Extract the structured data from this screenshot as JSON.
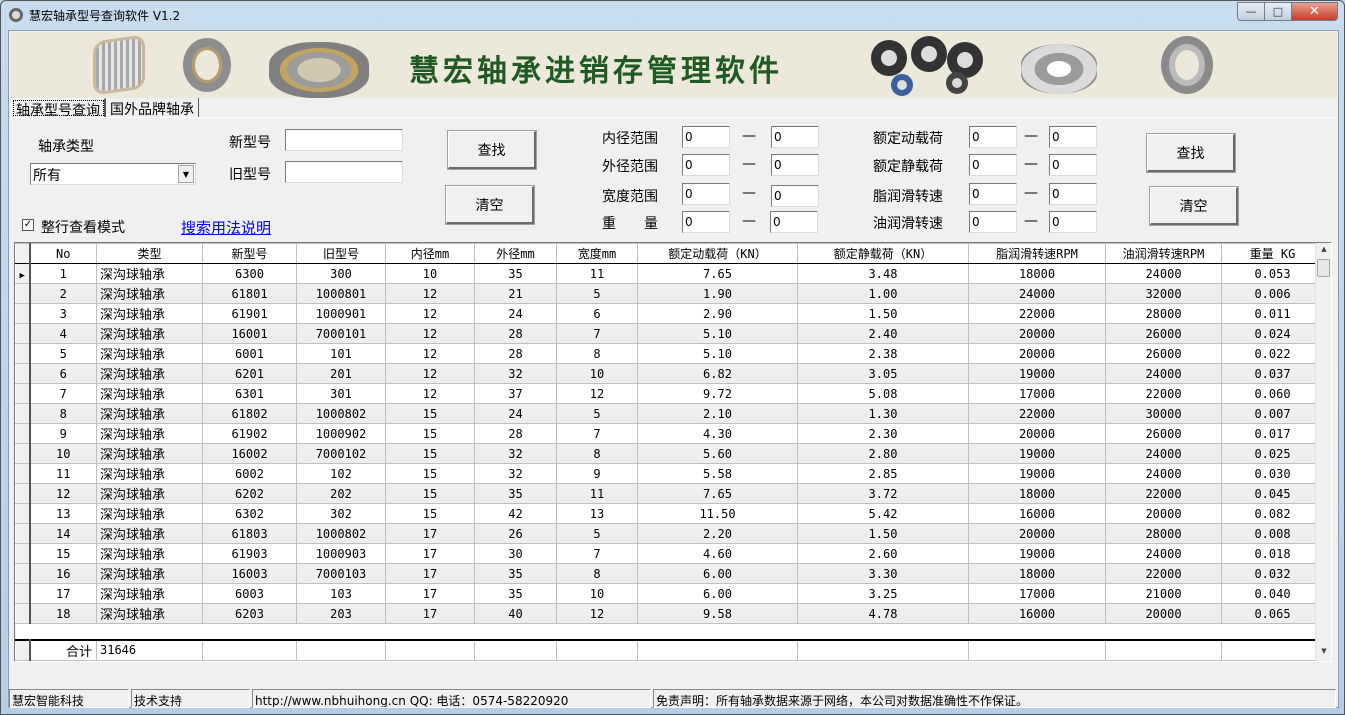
{
  "window": {
    "title": "慧宏轴承型号查询软件 V1.2",
    "minimize": "—",
    "maximize": "□",
    "close": "✕"
  },
  "banner": {
    "title": "慧宏轴承进销存管理软件"
  },
  "tabs": [
    {
      "label": "轴承型号查询",
      "active": true
    },
    {
      "label": "国外品牌轴承",
      "active": false
    }
  ],
  "search": {
    "type_label": "轴承类型",
    "type_value": "所有",
    "new_model_label": "新型号",
    "new_model_value": "",
    "old_model_label": "旧型号",
    "old_model_value": "",
    "find_button": "查找",
    "clear_button": "清空",
    "row_view_label": "整行查看模式",
    "row_view_checked": true,
    "help_link": "搜索用法说明",
    "dash": "—",
    "ranges_left": [
      {
        "label": "内径范围",
        "from": "0",
        "to": "0"
      },
      {
        "label": "外径范围",
        "from": "0",
        "to": "0"
      },
      {
        "label": "宽度范围",
        "from": "0",
        "to": "0"
      },
      {
        "label": "重　　量",
        "from": "0",
        "to": "0"
      }
    ],
    "ranges_right": [
      {
        "label": "额定动载荷",
        "from": "0",
        "to": "0"
      },
      {
        "label": "额定静载荷",
        "from": "0",
        "to": "0"
      },
      {
        "label": "脂润滑转速",
        "from": "0",
        "to": "0"
      },
      {
        "label": "油润滑转速",
        "from": "0",
        "to": "0"
      }
    ],
    "find_button_2": "查找",
    "clear_button_2": "清空"
  },
  "table": {
    "columns": [
      "No",
      "类型",
      "新型号",
      "旧型号",
      "内径mm",
      "外径mm",
      "宽度mm",
      "额定动载荷（KN）",
      "额定静载荷（KN）",
      "脂润滑转速RPM",
      "油润滑转速RPM",
      "重量 KG"
    ],
    "rows": [
      [
        "1",
        "深沟球轴承",
        "6300",
        "300",
        "10",
        "35",
        "11",
        "7.65",
        "3.48",
        "18000",
        "24000",
        "0.053"
      ],
      [
        "2",
        "深沟球轴承",
        "61801",
        "1000801",
        "12",
        "21",
        "5",
        "1.90",
        "1.00",
        "24000",
        "32000",
        "0.006"
      ],
      [
        "3",
        "深沟球轴承",
        "61901",
        "1000901",
        "12",
        "24",
        "6",
        "2.90",
        "1.50",
        "22000",
        "28000",
        "0.011"
      ],
      [
        "4",
        "深沟球轴承",
        "16001",
        "7000101",
        "12",
        "28",
        "7",
        "5.10",
        "2.40",
        "20000",
        "26000",
        "0.024"
      ],
      [
        "5",
        "深沟球轴承",
        "6001",
        "101",
        "12",
        "28",
        "8",
        "5.10",
        "2.38",
        "20000",
        "26000",
        "0.022"
      ],
      [
        "6",
        "深沟球轴承",
        "6201",
        "201",
        "12",
        "32",
        "10",
        "6.82",
        "3.05",
        "19000",
        "24000",
        "0.037"
      ],
      [
        "7",
        "深沟球轴承",
        "6301",
        "301",
        "12",
        "37",
        "12",
        "9.72",
        "5.08",
        "17000",
        "22000",
        "0.060"
      ],
      [
        "8",
        "深沟球轴承",
        "61802",
        "1000802",
        "15",
        "24",
        "5",
        "2.10",
        "1.30",
        "22000",
        "30000",
        "0.007"
      ],
      [
        "9",
        "深沟球轴承",
        "61902",
        "1000902",
        "15",
        "28",
        "7",
        "4.30",
        "2.30",
        "20000",
        "26000",
        "0.017"
      ],
      [
        "10",
        "深沟球轴承",
        "16002",
        "7000102",
        "15",
        "32",
        "8",
        "5.60",
        "2.80",
        "19000",
        "24000",
        "0.025"
      ],
      [
        "11",
        "深沟球轴承",
        "6002",
        "102",
        "15",
        "32",
        "9",
        "5.58",
        "2.85",
        "19000",
        "24000",
        "0.030"
      ],
      [
        "12",
        "深沟球轴承",
        "6202",
        "202",
        "15",
        "35",
        "11",
        "7.65",
        "3.72",
        "18000",
        "22000",
        "0.045"
      ],
      [
        "13",
        "深沟球轴承",
        "6302",
        "302",
        "15",
        "42",
        "13",
        "11.50",
        "5.42",
        "16000",
        "20000",
        "0.082"
      ],
      [
        "14",
        "深沟球轴承",
        "61803",
        "1000802",
        "17",
        "26",
        "5",
        "2.20",
        "1.50",
        "20000",
        "28000",
        "0.008"
      ],
      [
        "15",
        "深沟球轴承",
        "61903",
        "1000903",
        "17",
        "30",
        "7",
        "4.60",
        "2.60",
        "19000",
        "24000",
        "0.018"
      ],
      [
        "16",
        "深沟球轴承",
        "16003",
        "7000103",
        "17",
        "35",
        "8",
        "6.00",
        "3.30",
        "18000",
        "22000",
        "0.032"
      ],
      [
        "17",
        "深沟球轴承",
        "6003",
        "103",
        "17",
        "35",
        "10",
        "6.00",
        "3.25",
        "17000",
        "21000",
        "0.040"
      ],
      [
        "18",
        "深沟球轴承",
        "6203",
        "203",
        "17",
        "40",
        "12",
        "9.58",
        "4.78",
        "16000",
        "20000",
        "0.065"
      ]
    ],
    "selected_row": 0,
    "total_label": "合计",
    "total_value": "31646"
  },
  "statusbar": {
    "company": "慧宏智能科技",
    "support": "技术支持",
    "contact": "http://www.nbhuihong.cn  QQ:  电话：0574-58220920",
    "disclaimer": "免责声明：所有轴承数据来源于网络，本公司对数据准确性不作保证。"
  }
}
